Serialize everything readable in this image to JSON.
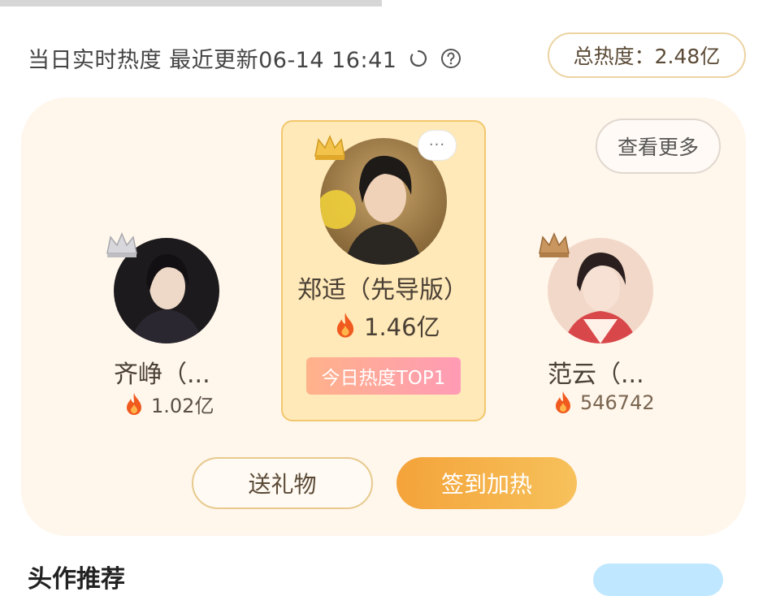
{
  "header": {
    "realtime_text": "当日实时热度 最近更新06-14 16:41",
    "total_heat": "总热度：2.48亿",
    "refresh_icon": "refresh-icon",
    "help_icon": "help-icon"
  },
  "ranking": {
    "more_label": "查看更多",
    "first": {
      "rank": "1",
      "name": "郑适（先导版）",
      "heat": "1.46亿",
      "badge": "今日热度TOP1",
      "bubble": "···"
    },
    "second": {
      "rank": "2",
      "name": "齐峥（...",
      "heat": "1.02亿"
    },
    "third": {
      "rank": "3",
      "name": "范云（...",
      "heat": "546742"
    }
  },
  "actions": {
    "gift_label": "送礼物",
    "checkin_label": "签到加热"
  },
  "section": {
    "title": "头作推荐"
  },
  "colors": {
    "panel_bg": "#fff6ec",
    "gold_border": "#f2c76d",
    "checkin_gradient_start": "#f4a33a",
    "checkin_gradient_end": "#f7c15b",
    "badge_gradient_start": "#ffb28a",
    "badge_gradient_end": "#ff9bb5",
    "flame": "#f05a1e"
  }
}
